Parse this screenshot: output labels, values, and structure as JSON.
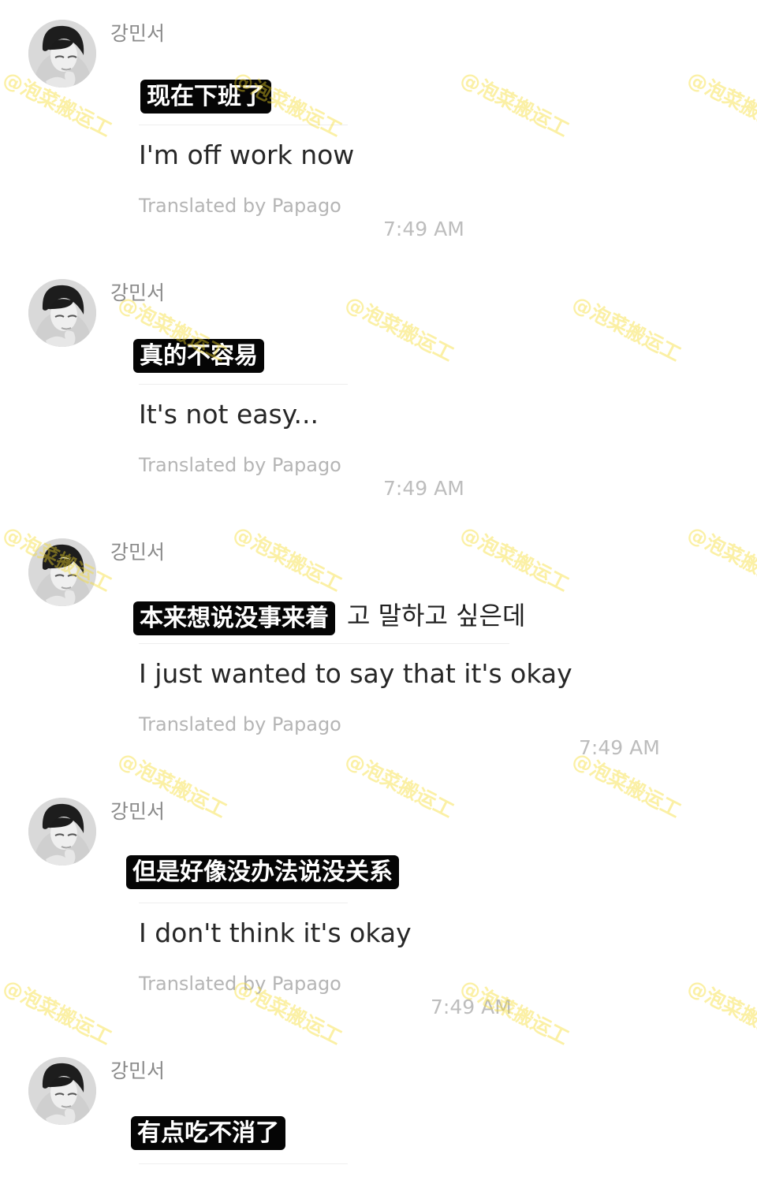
{
  "messages": [
    {
      "sender": "강민서",
      "original": "",
      "subtitle": "现在下班了",
      "translation": "I'm off work now",
      "credit": "Translated by Papago",
      "time": "7:49 AM"
    },
    {
      "sender": "강민서",
      "original": "",
      "subtitle": "真的不容易",
      "translation": "It's not easy...",
      "credit": "Translated by Papago",
      "time": "7:49 AM"
    },
    {
      "sender": "강민서",
      "original": "고 말하고 싶은데",
      "subtitle": "本来想说没事来着",
      "translation": "I just wanted to say that it's okay",
      "credit": "Translated by Papago",
      "time": "7:49 AM"
    },
    {
      "sender": "강민서",
      "original": "",
      "subtitle": "但是好像没办法说没关系",
      "translation": "I don't think it's okay",
      "credit": "Translated by Papago",
      "time": "7:49 AM"
    },
    {
      "sender": "강민서",
      "original": "",
      "subtitle": "有点吃不消了",
      "translation": "",
      "credit": "",
      "time": ""
    }
  ],
  "watermark": "@泡菜搬运工",
  "colors": {
    "background": "#ffffff",
    "subtitle_background": "#050505",
    "subtitle_text": "#ffffff",
    "credit_text": "#b5b5b5",
    "watermark": "#f5dc28"
  },
  "icons": {
    "avatar": "person-photo-avatar-icon"
  }
}
